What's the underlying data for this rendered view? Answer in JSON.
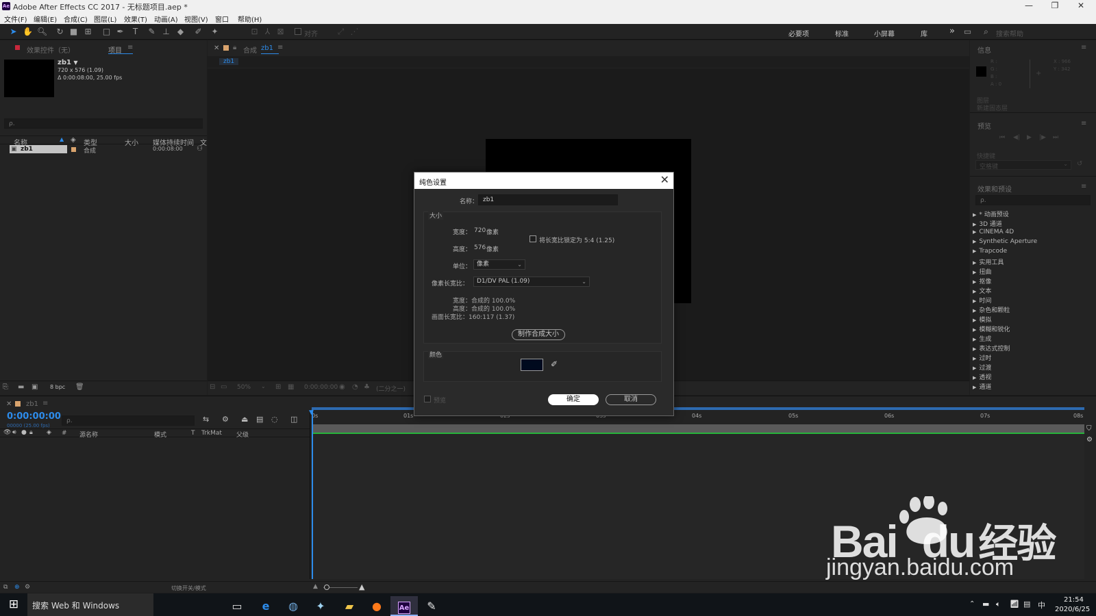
{
  "window": {
    "title": "Adobe After Effects CC 2017 - 无标题项目.aep *",
    "logo_text": "Ae",
    "minimize": "—",
    "maximize": "❐",
    "close": "✕"
  },
  "menubar": [
    "文件(F)",
    "编辑(E)",
    "合成(C)",
    "图层(L)",
    "效果(T)",
    "动画(A)",
    "视图(V)",
    "窗口",
    "帮助(H)"
  ],
  "toolbar": {
    "align_label": "对齐",
    "workspaces": [
      "必要项",
      "标准",
      "小屏幕",
      "库"
    ],
    "overflow": "»",
    "search_placeholder": "搜索帮助"
  },
  "project_panel": {
    "tab_effects": "效果控件（无）",
    "tab_project": "项目",
    "comp_name": "zb1",
    "comp_size": "720 x 576 (1.09)",
    "comp_duration": "Δ 0:00:08:00, 25.00 fps",
    "search_placeholder": "ρ.",
    "columns": [
      "名称",
      "类型",
      "大小",
      "媒体持续时间",
      "文"
    ],
    "items": [
      {
        "name": "zb1",
        "type": "合成",
        "size": "",
        "duration": "0:00:08:00"
      }
    ],
    "bpc": "8 bpc"
  },
  "composition_panel": {
    "tab_label": "合成",
    "comp_name": "zb1",
    "flow_tab": "zb1",
    "zoom": "50%",
    "timecode": "0:00:00:00",
    "resolution": "(二分之一)"
  },
  "info_panel": {
    "title": "信息",
    "r": "R :",
    "g": "G :",
    "b": "B :",
    "a": "A : 0",
    "x": "X : 966",
    "y": "Y : 342",
    "line1": "图层",
    "line2": "新建固态层"
  },
  "preview_panel": {
    "title": "预览",
    "shortcut_label": "快捷键",
    "shortcut_value": "空格键"
  },
  "effects_panel": {
    "title": "效果和预设",
    "search_placeholder": "ρ.",
    "items": [
      "* 动画预设",
      "3D 通道",
      "CINEMA 4D",
      "Synthetic Aperture",
      "Trapcode",
      "实用工具",
      "扭曲",
      "抠像",
      "文本",
      "时间",
      "杂色和颗粒",
      "模拟",
      "模糊和锐化",
      "生成",
      "表达式控制",
      "过时",
      "过渡",
      "透视",
      "通道"
    ]
  },
  "timeline": {
    "tab_label": "zb1",
    "timecode": "0:00:00:00",
    "frame_info": "00000 (25.00 fps)",
    "search_placeholder": "ρ.",
    "columns": [
      "源名称",
      "模式",
      "T",
      "TrkMat",
      "父级"
    ],
    "ruler": [
      "0s",
      "01s",
      "02s",
      "03s",
      "04s",
      "05s",
      "06s",
      "07s",
      "08s"
    ],
    "footer_label": "切换开关/模式",
    "col_hash": "#"
  },
  "dialog": {
    "title": "纯色设置",
    "close": "✕",
    "name_label": "名称：",
    "name_value": "zb1",
    "size_section": "大小",
    "width_label": "宽度：",
    "width_value": "720",
    "width_unit": "像素",
    "height_label": "高度：",
    "height_value": "576",
    "height_unit": "像素",
    "lock_label": "将长宽比锁定为 5:4 (1.25)",
    "lock_checked": false,
    "units_label": "单位：",
    "units_value": "像素",
    "par_label": "像素长宽比：",
    "par_value": "D1/DV PAL (1.09)",
    "info_width": "宽度：合成的 100.0%",
    "info_height": "高度：合成的 100.0%",
    "info_frame": "画面长宽比：160:117 (1.37)",
    "make_comp_size": "制作合成大小",
    "color_section": "颜色",
    "color_value": "#000a1e",
    "preview_label": "预览",
    "ok": "确定",
    "cancel": "取消"
  },
  "taskbar": {
    "search_text": "搜索 Web 和 Windows",
    "time": "21:54",
    "date": "2020/6/25",
    "ime": "中"
  },
  "watermark": {
    "brand": "Bai",
    "brand_du": "du",
    "cn": "经验",
    "url": "jingyan.baidu.com"
  }
}
